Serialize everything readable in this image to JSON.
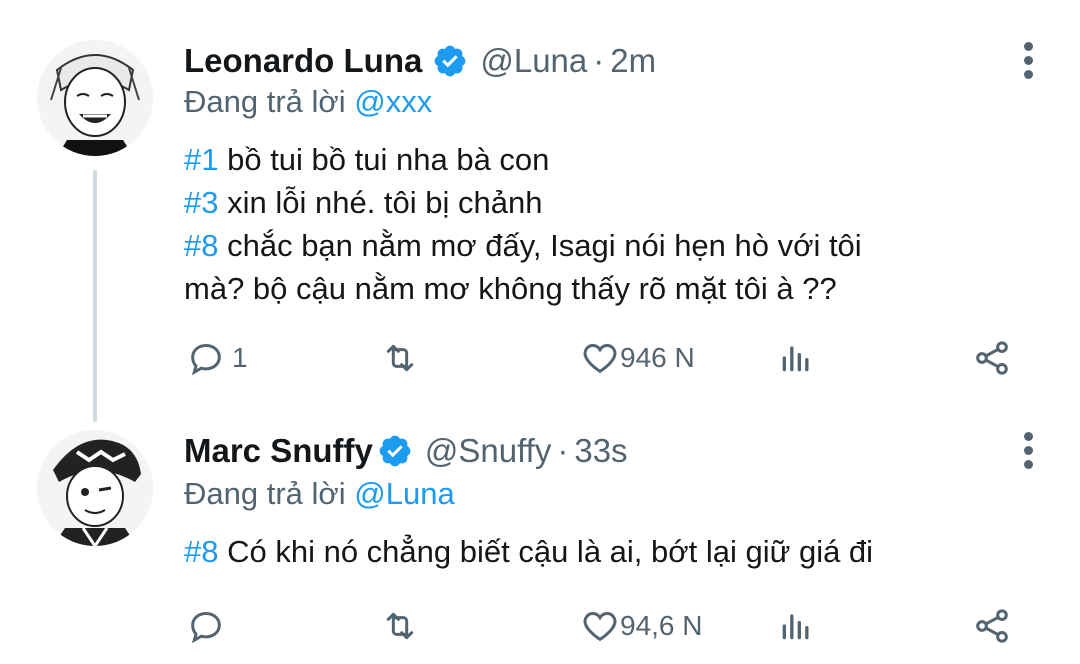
{
  "tweets": [
    {
      "name": "Leonardo Luna",
      "handle": "@Luna",
      "dot": "·",
      "time": "2m",
      "reply_prefix": "Đang trả lời",
      "reply_to": "@xxx",
      "lines": [
        {
          "tag": "#1",
          "text": " bồ tui bồ tui nha bà con"
        },
        {
          "tag": "#3",
          "text": " xin lỗi nhé. tôi bị chảnh"
        },
        {
          "tag": "#8",
          "text": " chắc bạn nằm mơ đấy, Isagi nói hẹn hò với tôi"
        },
        {
          "tag": "",
          "text": "mà? bộ cậu nằm mơ không thấy rõ mặt tôi à ??"
        }
      ],
      "replies": "1",
      "retweets": "",
      "likes": "946 N"
    },
    {
      "name": "Marc Snuffy",
      "handle": "@Snuffy",
      "dot": "·",
      "time": "33s",
      "reply_prefix": "Đang trả lời",
      "reply_to": "@Luna",
      "lines": [
        {
          "tag": "#8",
          "text": " Có khi nó chẳng biết cậu là ai, bớt lại giữ giá đi"
        }
      ],
      "replies": "",
      "retweets": "",
      "likes": "94,6 N"
    }
  ],
  "icons": {
    "reply": "reply-icon",
    "retweet": "retweet-icon",
    "like": "heart-icon",
    "analytics": "analytics-icon",
    "share": "share-icon",
    "more": "more-vertical-icon",
    "verified": "verified-badge-icon"
  },
  "colors": {
    "accent": "#1d9bf0",
    "text": "#14171a",
    "muted": "#536471",
    "thread_line": "#cfd9de"
  }
}
